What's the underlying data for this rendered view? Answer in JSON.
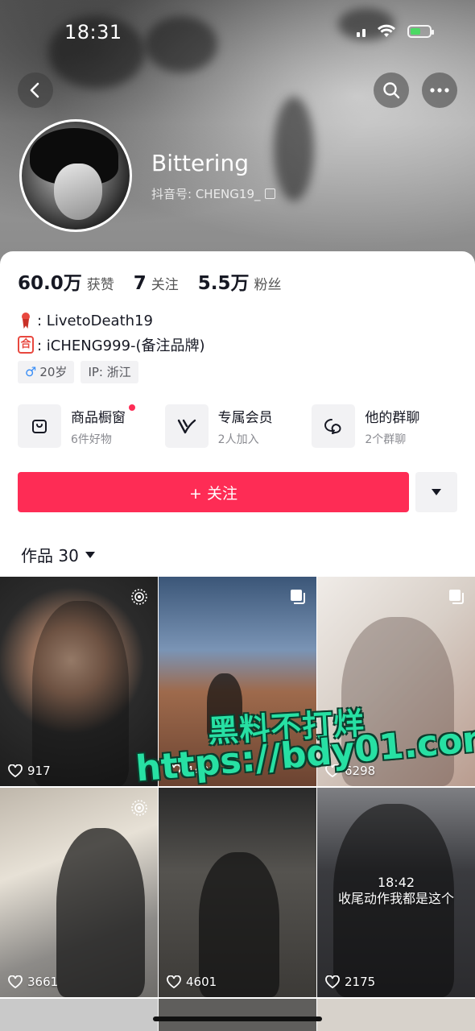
{
  "status_bar": {
    "time": "18:31"
  },
  "profile": {
    "nickname": "Bittering",
    "douyin_id": "抖音号: CHENG19_"
  },
  "stats": [
    {
      "value": "60.0万",
      "label": "获赞"
    },
    {
      "value": "7",
      "label": "关注"
    },
    {
      "value": "5.5万",
      "label": "粉丝"
    }
  ],
  "bio": [
    {
      "icon": "ribbon-icon",
      "text": ": LivetoDeath19"
    },
    {
      "icon": "ban-icon",
      "icon_text": "合",
      "text": ": iCHENG999-(备注品牌)"
    }
  ],
  "tags": {
    "gender_age": "20岁",
    "ip": "IP: 浙江"
  },
  "features": [
    {
      "icon": "bag-icon",
      "title": "商品橱窗",
      "sub": "6件好物"
    },
    {
      "icon": "vip-icon",
      "title": "专属会员",
      "sub": "2人加入"
    },
    {
      "icon": "chat-icon",
      "title": "他的群聊",
      "sub": "2个群聊"
    }
  ],
  "actions": {
    "follow_label": "+ 关注"
  },
  "works_tab": {
    "label": "作品 30"
  },
  "grid": [
    {
      "likes": "917",
      "type_icon": "live-icon"
    },
    {
      "likes": "4437",
      "type_icon": "gallery-icon"
    },
    {
      "likes": "6298",
      "type_icon": "gallery-icon"
    },
    {
      "likes": "3661",
      "type_icon": "live-icon"
    },
    {
      "likes": "4601",
      "type_icon": ""
    },
    {
      "likes": "2175",
      "type_icon": "",
      "caption_line1": "18:42",
      "caption_line2": "收尾动作我都是这个"
    }
  ],
  "watermark": {
    "line1": "黑料不打烊",
    "line2": "https://bdy01.com"
  },
  "colors": {
    "accent": "#fe2c55",
    "watermark": "#27e0a3"
  }
}
